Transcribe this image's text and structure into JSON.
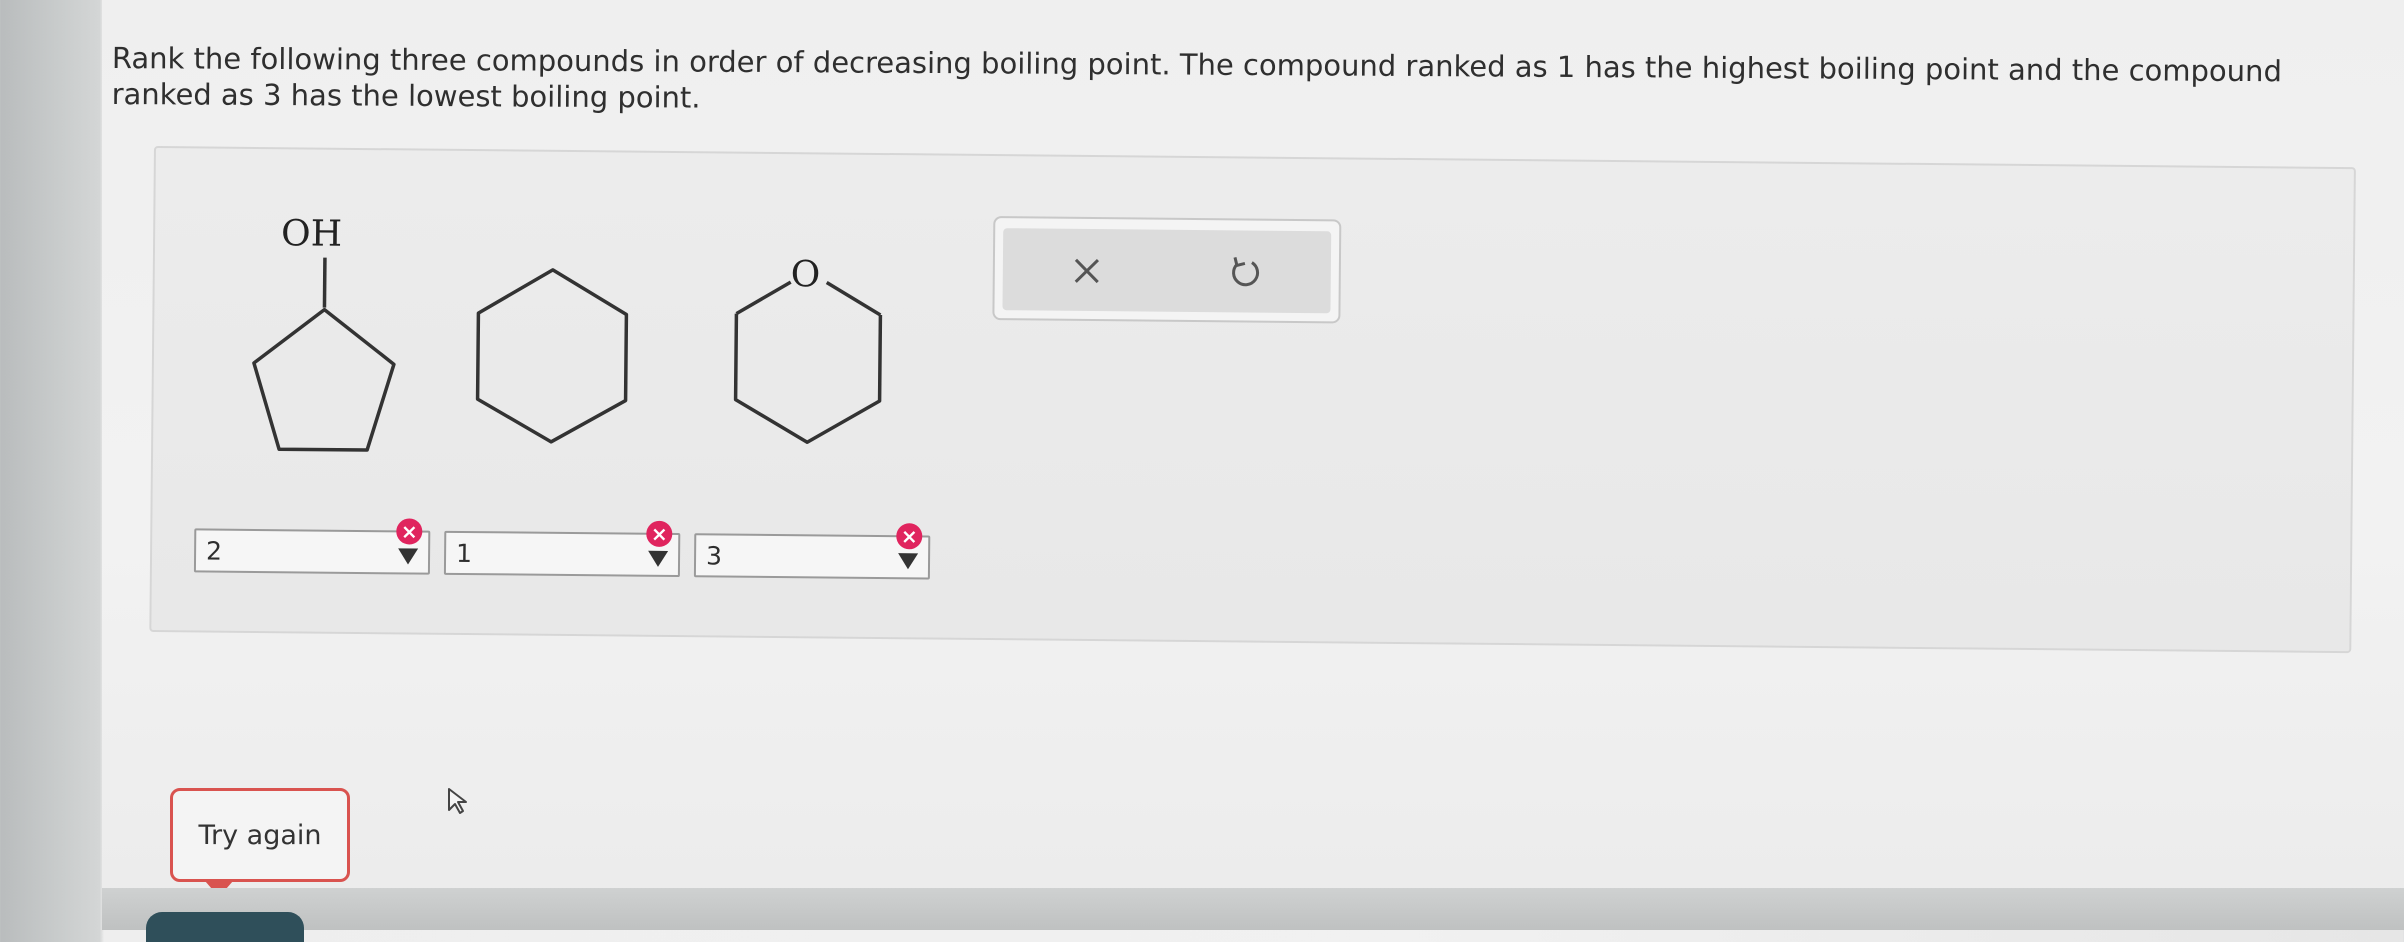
{
  "question": {
    "text": "Rank the following three compounds in order of decreasing boiling point. The compound ranked as 1 has the highest boiling point and the compound ranked as 3 has the lowest boiling point."
  },
  "molecules": [
    {
      "name": "cyclopentanol",
      "label": "OH"
    },
    {
      "name": "cyclohexane"
    },
    {
      "name": "tetrahydropyran",
      "label": "O"
    }
  ],
  "toolbar": {
    "clear_icon": "close-icon",
    "undo_icon": "undo-icon"
  },
  "rankings": [
    {
      "value": "2",
      "status": "incorrect"
    },
    {
      "value": "1",
      "status": "incorrect"
    },
    {
      "value": "3",
      "status": "incorrect"
    }
  ],
  "feedback": {
    "try_again_label": "Try again"
  },
  "colors": {
    "error": "#e0245e",
    "try_again_border": "#d9534f"
  }
}
